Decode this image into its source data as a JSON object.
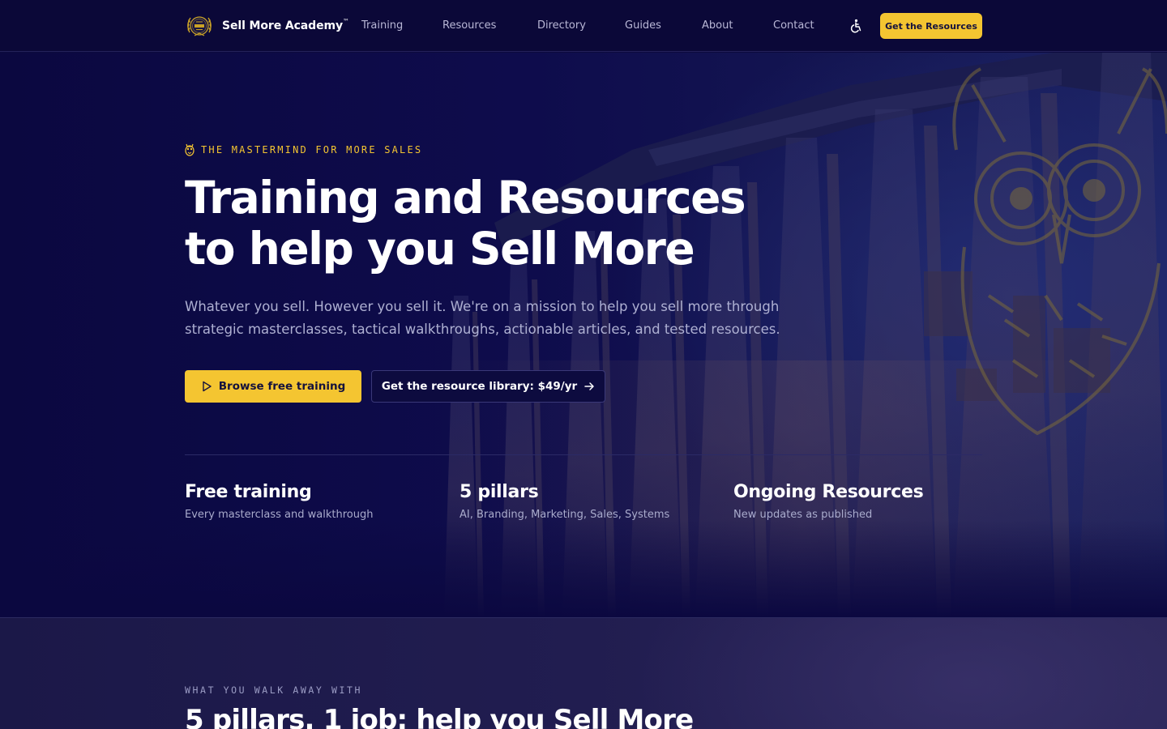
{
  "nav": {
    "brand": "Sell More Academy",
    "brand_tm": "™",
    "items": [
      "Training",
      "Resources",
      "Directory",
      "Guides",
      "About",
      "Contact"
    ],
    "cta": "Get the Resources"
  },
  "hero": {
    "eyebrow": "THE MASTERMIND FOR MORE SALES",
    "title_line1": "Training and Resources",
    "title_line2": "to help you Sell More",
    "subtitle": "Whatever you sell. However you sell it. We're on a mission to help you sell more through strategic masterclasses, tactical walkthroughs, actionable articles, and tested resources.",
    "primary_button": "Browse free training",
    "secondary_button": "Get the resource library: $49/yr",
    "stats": [
      {
        "title": "Free training",
        "desc": "Every masterclass and walkthrough"
      },
      {
        "title": "5 pillars",
        "desc": "AI, Branding, Marketing, Sales, Systems"
      },
      {
        "title": "Ongoing Resources",
        "desc": "New updates as published"
      }
    ]
  },
  "section2": {
    "eyebrow": "WHAT YOU WALK AWAY WITH",
    "title": "5 pillars. 1 job: help you Sell More"
  },
  "colors": {
    "accent": "#f4c531",
    "nav_bg": "#0b0838",
    "hero_bg": "#0c0a3e"
  },
  "icons": {
    "logo": "laurel-badge-logo",
    "accessibility": "accessibility-icon",
    "eyebrow": "owl-icon",
    "play": "play-icon",
    "arrow": "arrow-right-icon",
    "background": "temple-columns-owl-illustration"
  }
}
